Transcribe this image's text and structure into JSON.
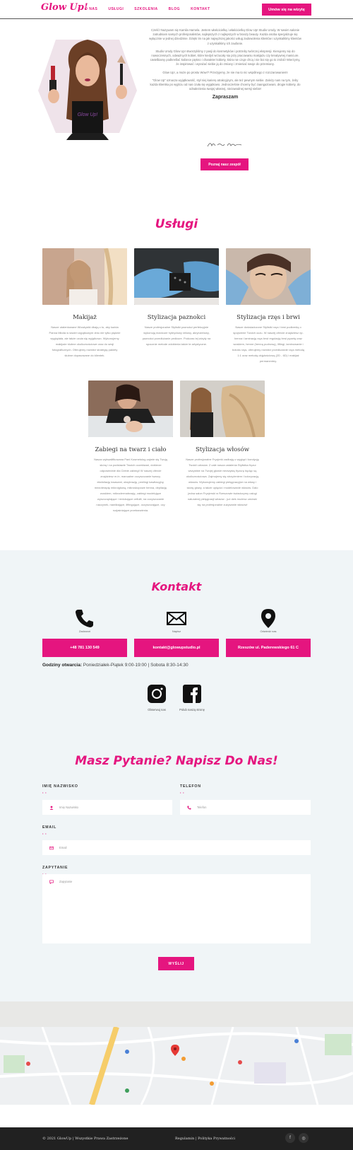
{
  "header": {
    "logo": "Glow Up!",
    "nav": [
      "O NAS",
      "USŁUGI",
      "SZKOLENIA",
      "BLOG",
      "KONTAKT"
    ],
    "cta": "Umów się na wizytę"
  },
  "about": {
    "paragraphs": [
      "Cześć! Nazywam się Kamila Hamela. Jestem właścicielką i właścicielką Glow Up! Studio Urody. W swoim salonie zatrudniam samych profesjonalistów, najlepszych z najlepszych w branży beauty. Każda osoba specjalizuje się wyłącznie w jednej dziedzinie. Dzięki tm na jak najwyższej jakości usług zadowolenia klientów i uzyskaliśmy klientów z uzyskaliśmy ich zaufanie.",
      "Studio Urody Glow Up! stworzyliśmy z pasji do kosmetyków i potrzeby twórczej ekspresji. Kierujemy się do nowoczesnych, odważnych kobiet, które kiedyś wrzucały się przy pracowaniu makijażu czy kreatywnej manicure. Uwielbiamy podkreślać kobiece piękno i charakter kobiety, która nie czuje chcą i nie boi się go to zrobić! Wierzymy, że inspirować i wyrażać siebie ją do zmiany i zmieniać swoje do przemiany.",
      "Glow Up!, a może po prostu Wow!? Przeżyjemy, że nie ma to nic wspólnego z rozczarowaniem!",
      "\"Glow Up\" oznacza wyjątkowość, styl niej karierę atrakcyjnym, ale też pewnym siebie. Zależy nam na tym, żeby każda klientka po wyjściu od nas czuła się wyjątkowo. Jednocześnie chcemy być zaangażowani, drogie kobiety, do odnalezienia swojej własnej, niezawodnej wersji siebie!"
    ],
    "invite": "Zapraszam",
    "team_button": "Poznaj nasz zespół"
  },
  "services": {
    "title": "Usługi",
    "items": [
      {
        "title": "Makijaż",
        "desc": "Nasze utalentowane Wizażystki dbają o to, aby każda Panna Młoda w swoim wyjątkowym dniu nie tylko pięknie wyglądała, ale także czuła się wyjątkowo. Wykonujemy makijaże ślubne okolicznościowe oraz do sesji fotograficznych. Oferujemy również strategię pakiety ślubne dopasowane do klientek."
      },
      {
        "title": "Stylizacja paznokci",
        "desc": "Nasze profesjonalne Stylistki paznokci perfekcyjnie wykonują manicure hybrydowy żelowy, akrylożelowy, paznokci przedłużanie pedicure. Podczas tej wizyty na spocznie metode zdobienia także te artystyczne."
      },
      {
        "title": "Stylizacja rzęs i brwi",
        "desc": "Nasze doświadczone Stylistki rzęs i brwi podkreślą o spojrzenie Twoich oczu. W naszej ofercie znajdziesz np. henna i laminację rzęs brwi regulację brwi pęsetą oraz woskiem, henne (henną pudrową), liftingi, laminowanie i botoks rzęs, oferujemy również przedłużanie rzęs metodą 1:1 oraz metodą objętościową (2D - 6D) i makijaż permanentny."
      },
      {
        "title": "Zabiegi na twarz i ciało",
        "desc": "Nasza wykwalifikowana Pani Kosmetolog zajmie się Twoją skórą i na podstawie Twoich oczekiwań, dobierze odpowiednie dla Ciebie zabiegi! W naszej ofercie znajdziesz m.in. manualne oczyszczanie twarzy, eksfoliację kwasami, oksybrazję, peelingi kawitacyjny, mezoterapię mikroigłową, mikroskopowe henna, depilację woskiem, mikrodermabrazję, zabiegi modelujące wyszczuplające i redukujące cellulit, na oczyszczanie naczynek, nawilżające, liftingujące, oczyszczające, czy rozjaśniające przebarwienia."
      },
      {
        "title": "Stylizacja włosów",
        "desc": "Nasze profesjonalne Fryzjerki zadbają o wygląd i kondycję Twoich włosów. Z całe nasza ustalenia Stylistka fryzur wszystkie na Twojej głowie niezwykłą fryzurę będąc są okolicznościowa. Zajmujemy się strzyżeniem i koloryzacją włosów. Wykonujemy zabiegi pielęgnacyjne na włosy i skórę głowy, a także upięcia i modelowanie włosów. Dalo jedna salon Fryzjerski w Rzeszowie świadczymy usługi naturalnej pielęgnacji włosów - już dziś możesz umówić się na profesjonalne zużywanie włosów!"
      }
    ]
  },
  "contact": {
    "title": "Kontakt",
    "captions": [
      "Zadzwoń",
      "Napisz",
      "Odwiedź nas"
    ],
    "buttons": [
      "+48 781 130 549",
      "kontakt@glowupstudio.pl",
      "Rzeszów ul. Paderewskiego 61 C"
    ],
    "hours_label": "Godziny otwarcia:",
    "hours": "Poniedziałek-Piątek 9:00-19:00 | Sobota 8:30-14:30",
    "social": [
      "Obserwuj nas",
      "Polub naszą stronę"
    ]
  },
  "form": {
    "title": "Masz Pytanie? Napisz Do Nas!",
    "name_label": "IMIĘ NAZWISKO",
    "name_placeholder": "Imię Nazwisko",
    "phone_label": "TELEFON",
    "phone_placeholder": "Telefon",
    "email_label": "EMAIL",
    "email_placeholder": "Email",
    "message_label": "ZAPYTANIE",
    "message_placeholder": "Zapytanie",
    "submit": "WYŚLIJ"
  },
  "footer": {
    "copyright": "© 2021 GlowUp | Wszystkie Prawa Zastrzeżone",
    "links": "Regulamin | Polityka Prywatności",
    "social": [
      "f",
      "◎"
    ]
  },
  "colors": {
    "accent": "#e5157f",
    "contact_bg": "#f0f5f7",
    "footer": "#212121"
  }
}
